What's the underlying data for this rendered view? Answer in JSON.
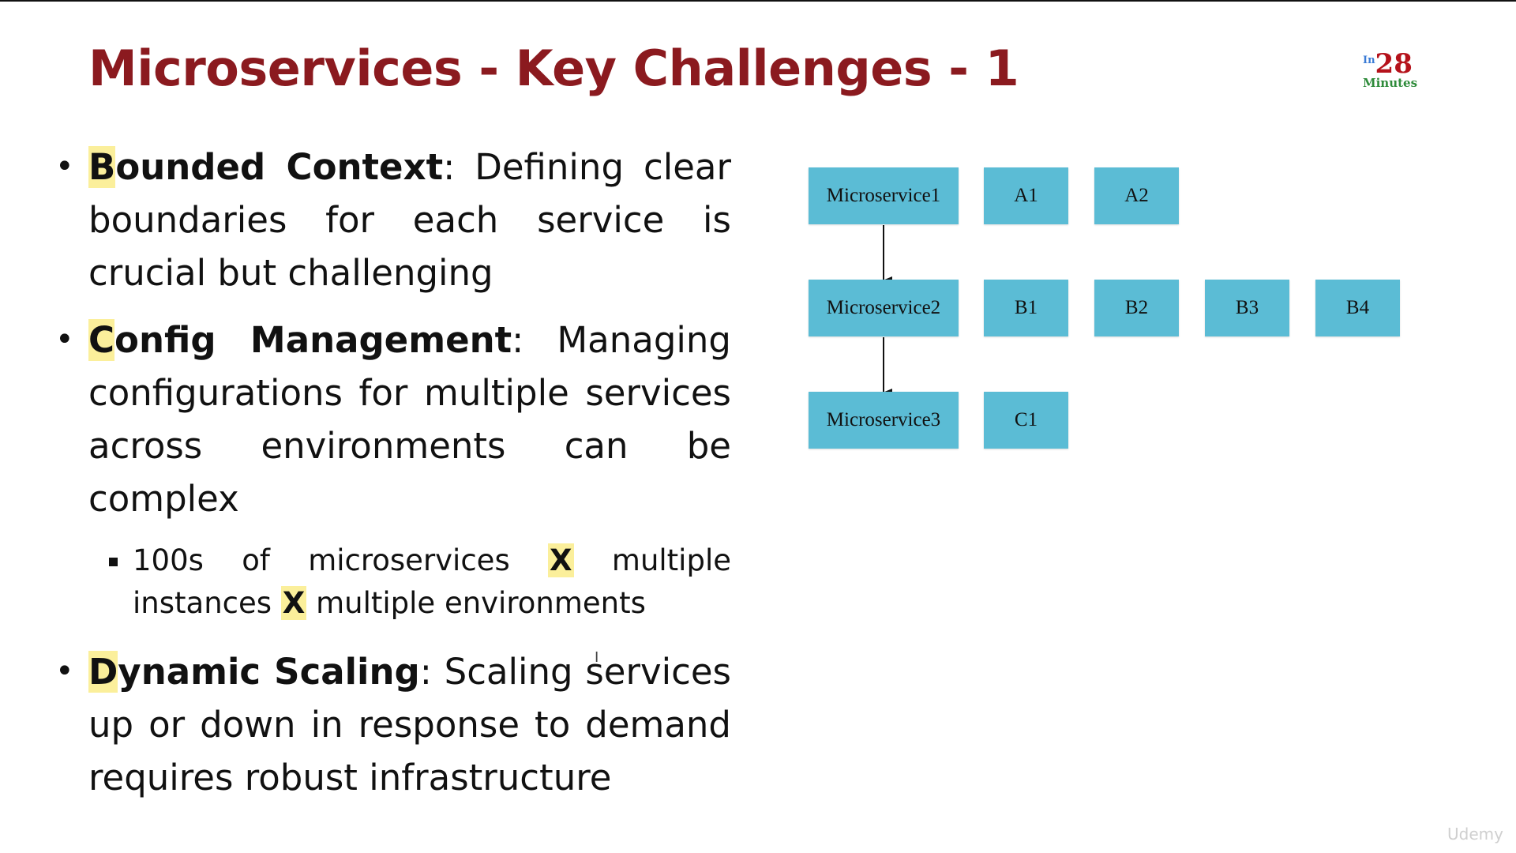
{
  "slide": {
    "title": "Microservices - Key Challenges - 1"
  },
  "logo": {
    "prefix": "In",
    "number": "28",
    "word": "Minutes"
  },
  "bullets": [
    {
      "term_first": "B",
      "term_rest": "ounded Context",
      "text": ": Defining clear boundaries for each service is crucial but challenging"
    },
    {
      "term_first": "C",
      "term_rest": "onfig Management",
      "text": ": Managing configurations for multiple services across environments can be complex",
      "sub": {
        "part1": "100s of microservices ",
        "x1": "X",
        "part2": " multiple instances ",
        "x2": "X",
        "part3": " multiple environments"
      }
    },
    {
      "term_first": "D",
      "term_rest": "ynamic Scaling",
      "text": ": Scaling services up or down in response to demand requires robust infrastructure"
    }
  ],
  "diagram": {
    "box_color": "#5bbcd5",
    "rows": [
      {
        "service": "Microservice1",
        "instances": [
          "A1",
          "A2"
        ]
      },
      {
        "service": "Microservice2",
        "instances": [
          "B1",
          "B2",
          "B3",
          "B4"
        ]
      },
      {
        "service": "Microservice3",
        "instances": [
          "C1"
        ]
      }
    ]
  },
  "watermark": "Udemy",
  "colors": {
    "title": "#8b1a1f",
    "highlight": "#fbef9b"
  }
}
